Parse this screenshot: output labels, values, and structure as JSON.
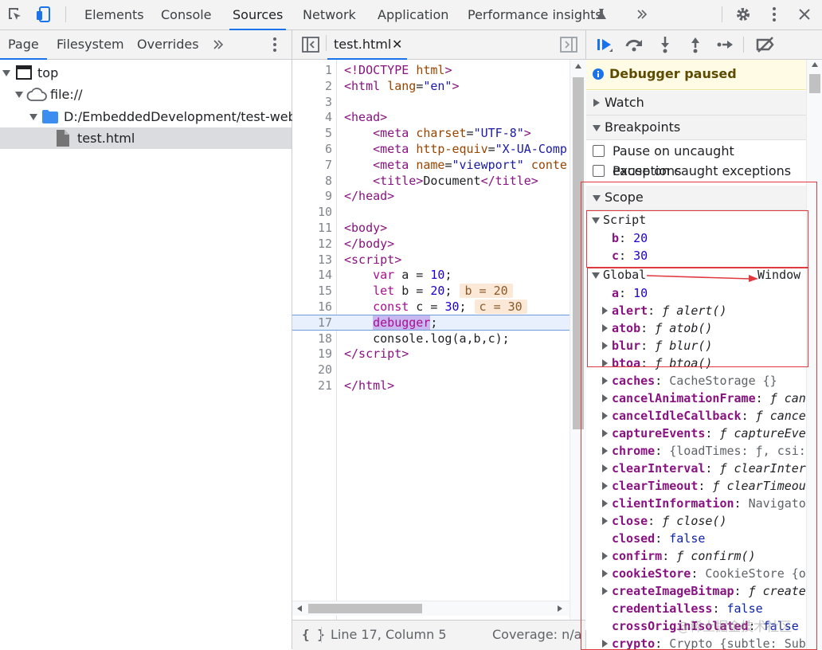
{
  "top_tabs": [
    "Elements",
    "Console",
    "Sources",
    "Network",
    "Application",
    "Performance insights"
  ],
  "active_top_tab": "Sources",
  "nav": {
    "tabs": [
      "Page",
      "Filesystem",
      "Overrides"
    ],
    "active_tab": "Page",
    "tree": [
      {
        "label": "top",
        "icon": "frame-icon",
        "depth": 0
      },
      {
        "label": "file://",
        "icon": "cloud-icon",
        "depth": 1
      },
      {
        "label": "D:/EmbeddedDevelopment/test-web",
        "icon": "folder-icon",
        "depth": 2
      },
      {
        "label": "test.html",
        "icon": "file-icon",
        "depth": 3,
        "selected": true
      }
    ]
  },
  "editor": {
    "tab_label": "test.html",
    "line_numbers": [
      "1",
      "2",
      "3",
      "4",
      "5",
      "6",
      "7",
      "8",
      "9",
      "10",
      "11",
      "12",
      "13",
      "14",
      "15",
      "16",
      "17",
      "18",
      "19",
      "20",
      "21"
    ],
    "paused_line": 17,
    "inline_values": {
      "b": "b = 20",
      "c": "c = 30"
    },
    "status_position": "Line 17, Column 5",
    "status_coverage": "Coverage: n/a",
    "format_icon_label": "{ }"
  },
  "debugger": {
    "paused_banner": "Debugger paused",
    "sections": {
      "watch": "Watch",
      "breakpoints": "Breakpoints",
      "scope": "Scope"
    },
    "checkboxes": [
      "Pause on uncaught exceptions",
      "Pause on caught exceptions"
    ],
    "script_scope": {
      "label": "Script",
      "vars": [
        {
          "name": "b",
          "value": "20"
        },
        {
          "name": "c",
          "value": "30"
        }
      ]
    },
    "global_scope": {
      "label": "Global",
      "type": "Window",
      "props": [
        {
          "name": "a",
          "value": "10",
          "kind": "num",
          "expandable": false
        },
        {
          "name": "alert",
          "value": "alert()",
          "kind": "fn",
          "expandable": true
        },
        {
          "name": "atob",
          "value": "atob()",
          "kind": "fn",
          "expandable": true
        },
        {
          "name": "blur",
          "value": "blur()",
          "kind": "fn",
          "expandable": true
        },
        {
          "name": "btoa",
          "value": "btoa()",
          "kind": "fn",
          "expandable": true
        },
        {
          "name": "caches",
          "value": "CacheStorage {}",
          "kind": "obj",
          "expandable": true
        },
        {
          "name": "cancelAnimationFrame",
          "value": "can",
          "kind": "fn",
          "expandable": true
        },
        {
          "name": "cancelIdleCallback",
          "value": "cance",
          "kind": "fn",
          "expandable": true
        },
        {
          "name": "captureEvents",
          "value": "captureEve",
          "kind": "fn",
          "expandable": true
        },
        {
          "name": "chrome",
          "value": "{loadTimes: ƒ, csi:",
          "kind": "obj",
          "expandable": true
        },
        {
          "name": "clearInterval",
          "value": "clearInter",
          "kind": "fn",
          "expandable": true
        },
        {
          "name": "clearTimeout",
          "value": "clearTimeou",
          "kind": "fn",
          "expandable": true
        },
        {
          "name": "clientInformation",
          "value": "Navigato",
          "kind": "obj",
          "expandable": true
        },
        {
          "name": "close",
          "value": "close()",
          "kind": "fn",
          "expandable": true
        },
        {
          "name": "closed",
          "value": "false",
          "kind": "bool",
          "expandable": false
        },
        {
          "name": "confirm",
          "value": "confirm()",
          "kind": "fn",
          "expandable": true
        },
        {
          "name": "cookieStore",
          "value": "CookieStore {o",
          "kind": "obj",
          "expandable": true
        },
        {
          "name": "createImageBitmap",
          "value": "create",
          "kind": "fn",
          "expandable": true
        },
        {
          "name": "credentialless",
          "value": "false",
          "kind": "bool",
          "expandable": false
        },
        {
          "name": "crossOriginIsolated",
          "value": "false",
          "kind": "bool",
          "expandable": false
        },
        {
          "name": "crypto",
          "value": "Crypto {subtle: Sub",
          "kind": "obj",
          "expandable": true
        }
      ]
    }
  },
  "watermark": "@稀土掘金技术社区",
  "colors": {
    "accent": "#1a73e8",
    "annotation": "#e0393e",
    "paused_bg": "#fffbe5"
  }
}
